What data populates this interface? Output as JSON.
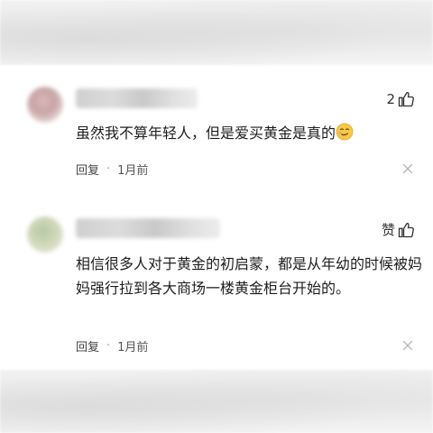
{
  "comments": [
    {
      "like_label": "2",
      "text": "虽然我不算年轻人，但是爱买黄金是真的",
      "emoji_icon": "smirk-emoji-icon",
      "reply_label": "回复",
      "separator": "·",
      "time": "1月前",
      "close_icon": "close-icon"
    },
    {
      "like_label": "赞",
      "text": "相信很多人对于黄金的初启蒙，都是从年幼的时候被妈妈强行拉到各大商场一楼黄金柜台开始的。",
      "reply_label": "回复",
      "separator": "·",
      "time": "1月前",
      "close_icon": "close-icon"
    }
  ],
  "colors": {
    "text": "#1e1e1e",
    "meta": "#444444",
    "background": "#ffffff"
  }
}
